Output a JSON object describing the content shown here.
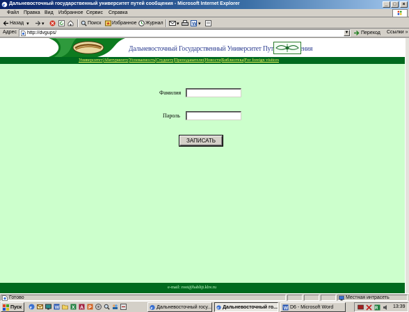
{
  "window": {
    "title": "Дальневосточный государственный университет путей сообщения - Microsoft Internet Explorer",
    "minimize": "_",
    "maximize": "□",
    "close": "×"
  },
  "menu": {
    "items": [
      "Файл",
      "Правка",
      "Вид",
      "Избранное",
      "Сервис",
      "Справка"
    ]
  },
  "toolbar": {
    "back": "Назад",
    "search": "Поиск",
    "favorites": "Избранное",
    "history": "Журнал"
  },
  "address": {
    "label": "Адрес",
    "url": "http://dvgups/",
    "go": "Переход",
    "links": "Ссылки »"
  },
  "site": {
    "title": "Дальневосточный Государственный Университет Путей Сообщения",
    "nav": [
      "Университет",
      "Абитуриенту",
      "Успеваемость",
      "Студенту",
      "Преподавателю",
      "Новости",
      "Библиотека",
      "For foreign visitors"
    ],
    "nav_separator": "|",
    "form": {
      "surname_label": "Фамилия",
      "surname_value": "",
      "password_label": "Пароль",
      "password_value": "",
      "submit": "ЗАПИСАТЬ"
    },
    "footer": "e-mail: root@hablijt.khv.ru"
  },
  "status": {
    "text": "Готово",
    "zone": "Местная интрасеть"
  },
  "taskbar": {
    "start": "Пуск",
    "tasks": [
      {
        "label": "Дальневосточный госу...",
        "active": false
      },
      {
        "label": "Дальневосточный го...",
        "active": true
      },
      {
        "label": "D6 - Microsoft Word",
        "active": false
      }
    ],
    "clock": "13:39"
  },
  "colors": {
    "page_bg": "#ccffcc",
    "nav_bar": "#006a1e",
    "nav_text": "#ffff66",
    "title_text": "#2a3b8f"
  }
}
